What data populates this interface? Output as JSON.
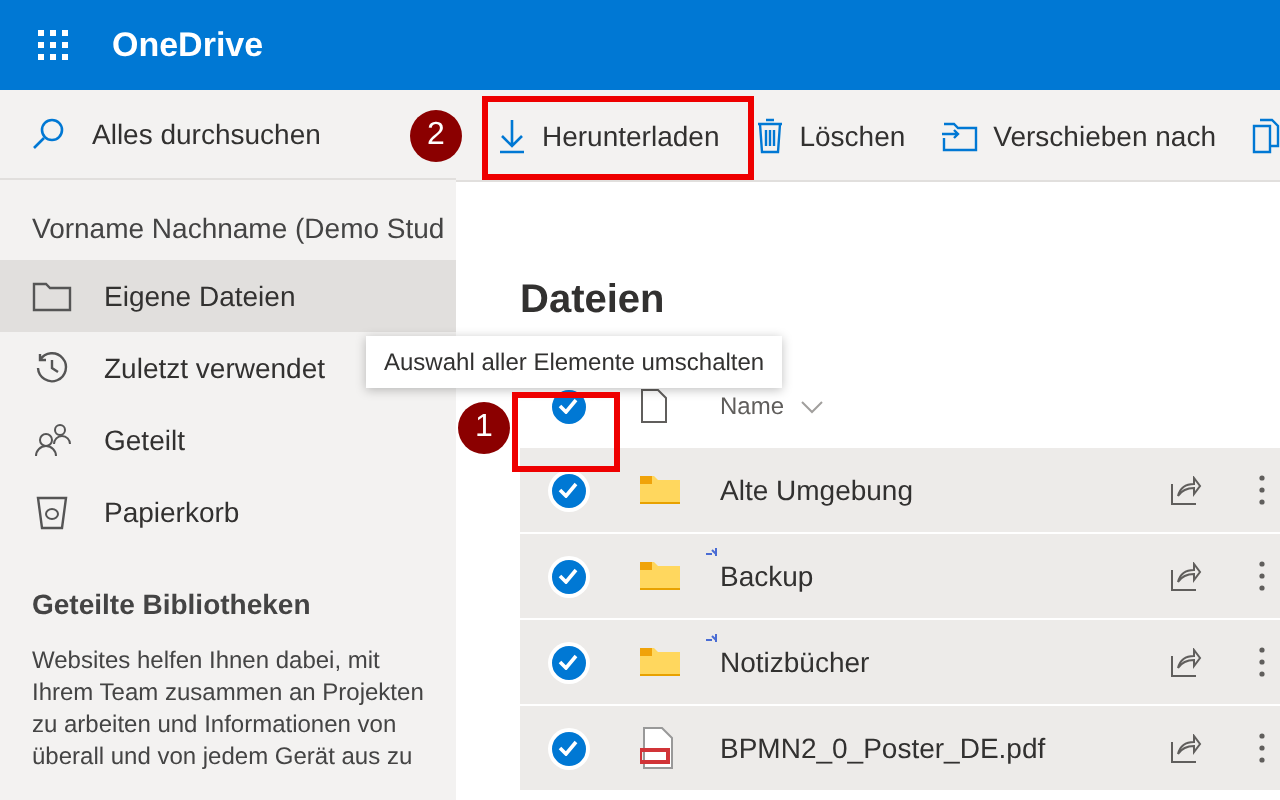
{
  "header": {
    "title": "OneDrive"
  },
  "search": {
    "placeholder": "Alles durchsuchen"
  },
  "sidebar": {
    "account": "Vorname Nachname (Demo Stud",
    "items": [
      {
        "label": "Eigene Dateien",
        "selected": true
      },
      {
        "label": "Zuletzt verwendet",
        "selected": false
      },
      {
        "label": "Geteilt",
        "selected": false
      },
      {
        "label": "Papierkorb",
        "selected": false
      }
    ],
    "section_title": "Geteilte Bibliotheken",
    "description_lines": [
      "Websites helfen Ihnen dabei, mit",
      "Ihrem Team zusammen an Projekten",
      "zu arbeiten und Informationen von",
      "überall und von jedem Gerät aus zu"
    ]
  },
  "toolbar": [
    {
      "label": "Herunterladen"
    },
    {
      "label": "Löschen"
    },
    {
      "label": "Verschieben nach"
    }
  ],
  "content": {
    "heading": "Dateien",
    "tooltip": "Auswahl aller Elemente umschalten",
    "select_all": {
      "checked": true
    },
    "column_name": "Name",
    "rows": [
      {
        "name": "Alte Umgebung",
        "kind": "folder",
        "selected": true,
        "new": false
      },
      {
        "name": "Backup",
        "kind": "folder",
        "selected": true,
        "new": true
      },
      {
        "name": "Notizbücher",
        "kind": "folder",
        "selected": true,
        "new": true
      },
      {
        "name": "BPMN2_0_Poster_DE.pdf",
        "kind": "pdf",
        "selected": true,
        "new": false
      }
    ]
  },
  "annotations": [
    {
      "number": "1"
    },
    {
      "number": "2"
    }
  ]
}
